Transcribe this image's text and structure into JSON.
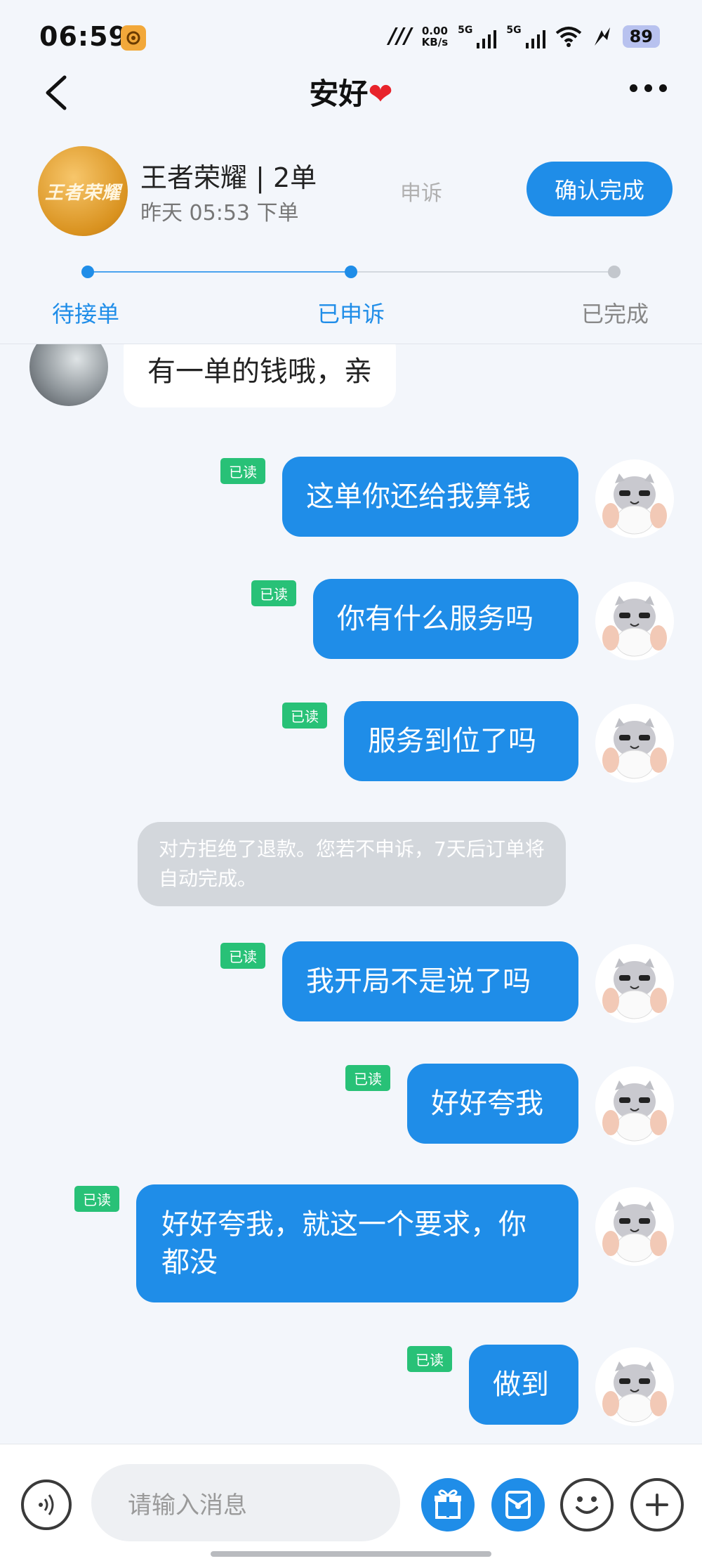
{
  "status_bar": {
    "time": "06:59",
    "net_speed_value": "0.00",
    "net_speed_unit": "KB/s",
    "signal1": "5G",
    "signal2": "5G",
    "battery": "89"
  },
  "header": {
    "title": "安好"
  },
  "order": {
    "title": "王者荣耀 | 2单",
    "time": "昨天 05:53 下单",
    "logo_text": "王者荣耀",
    "appeal_label": "申诉",
    "confirm_label": "确认完成",
    "steps": [
      "待接单",
      "已申诉",
      "已完成"
    ]
  },
  "messages": {
    "m0": "有一单的钱哦，亲",
    "m1": "这单你还给我算钱",
    "m2": "你有什么服务吗",
    "m3": "服务到位了吗",
    "system": "对方拒绝了退款。您若不申诉，7天后订单将自动完成。",
    "m4": "我开局不是说了吗",
    "m5": "好好夸我",
    "m6": "好好夸我，就这一个要求，你都没",
    "m7": "做到",
    "read_label": "已读"
  },
  "input": {
    "placeholder": "请输入消息"
  },
  "colors": {
    "accent": "#1f8de8",
    "read_badge": "#28c177",
    "heart": "#e8232b"
  }
}
